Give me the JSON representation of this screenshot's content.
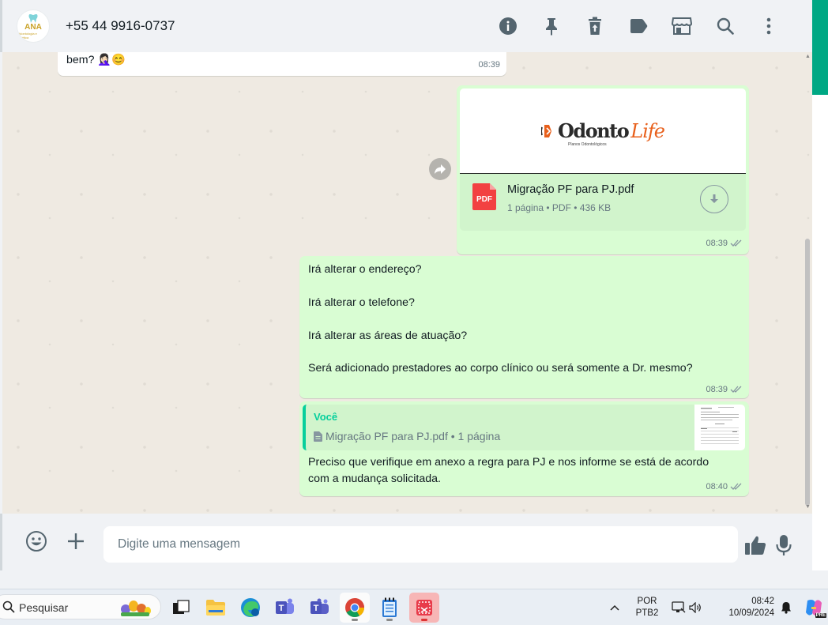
{
  "header": {
    "contact_name": "+55 44 9916-0737",
    "avatar_text": "ANA",
    "avatar_sub": "Odontologia e Estética",
    "icons": [
      "info-icon",
      "pin-icon",
      "delete-icon",
      "label-icon",
      "store-icon",
      "search-icon",
      "menu-icon"
    ]
  },
  "messages": {
    "m0": {
      "text": "bem? 🤦🏻‍♀️😊",
      "time": "08:39"
    },
    "doc": {
      "logo_a": "Odonto",
      "logo_b": "Life",
      "logo_sub": "Planos Odontológicos",
      "pdf_badge": "PDF",
      "name": "Migração PF para PJ.pdf",
      "meta": "1 página • PDF • 436 KB",
      "time": "08:39"
    },
    "m2": {
      "text": "Irá alterar o endereço?\n\nIrá alterar o telefone?\n\nIrá alterar as áreas de atuação?\n\nSerá adicionado prestadores ao corpo clínico ou será somente a Dr. mesmo?",
      "time": "08:39"
    },
    "m3": {
      "quote_author": "Você",
      "quote_text": "Migração PF para PJ.pdf • 1 página",
      "text": "Preciso que verifique em anexo a regra para PJ e nos informe se está de acordo\ncom a mudança solicitada.",
      "time": "08:40"
    }
  },
  "compose": {
    "placeholder": "Digite uma mensagem",
    "value": ""
  },
  "taskbar": {
    "search_label": "Pesquisar",
    "lang_top": "POR",
    "lang_bottom": "PTB2",
    "clock_time": "08:42",
    "clock_date": "10/09/2024",
    "copilot_badge": "PRE"
  },
  "colors": {
    "accent": "#00a884",
    "outgoing_bubble": "#d9fdd3",
    "incoming_bubble": "#ffffff",
    "chat_bg": "#efeae2",
    "quote_accent": "#06cf9c"
  }
}
